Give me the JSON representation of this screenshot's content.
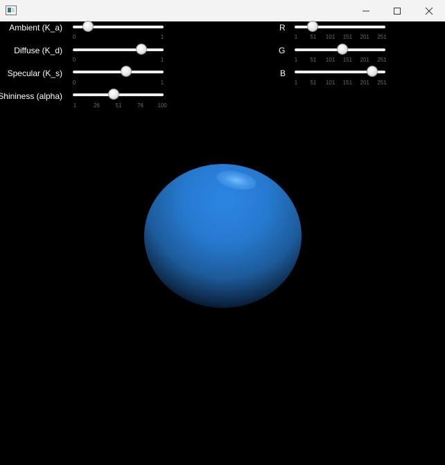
{
  "window": {
    "title": "",
    "icons": {
      "app": "app-window-icon",
      "minimize": "minimize-icon",
      "maximize": "maximize-icon",
      "close": "close-icon"
    }
  },
  "controls": {
    "ambient": {
      "label": "Ambient (K_a)",
      "value": 0.12,
      "min": 0,
      "max": 1,
      "ticks": [
        "0",
        "1"
      ]
    },
    "diffuse": {
      "label": "Diffuse (K_d)",
      "value": 0.79,
      "min": 0,
      "max": 1,
      "ticks": [
        "0",
        "1"
      ]
    },
    "specular": {
      "label": "Specular (K_s)",
      "value": 0.6,
      "min": 0,
      "max": 1,
      "ticks": [
        "0",
        "1"
      ]
    },
    "shininess": {
      "label": "Shininess (alpha)",
      "value": 45,
      "min": 1,
      "max": 100,
      "ticks": [
        "1",
        "26",
        "51",
        "76",
        "100"
      ]
    },
    "r": {
      "label": "R",
      "value": 41,
      "min": 1,
      "max": 251,
      "ticks": [
        "1",
        "51",
        "101",
        "151",
        "201",
        "251"
      ]
    },
    "g": {
      "label": "G",
      "value": 134,
      "min": 1,
      "max": 251,
      "ticks": [
        "1",
        "51",
        "101",
        "151",
        "201",
        "251"
      ]
    },
    "b": {
      "label": "B",
      "value": 228,
      "min": 1,
      "max": 251,
      "ticks": [
        "1",
        "51",
        "101",
        "151",
        "201",
        "251"
      ]
    }
  },
  "render": {
    "sphere_color": "#2986e4",
    "background": "#000000"
  }
}
